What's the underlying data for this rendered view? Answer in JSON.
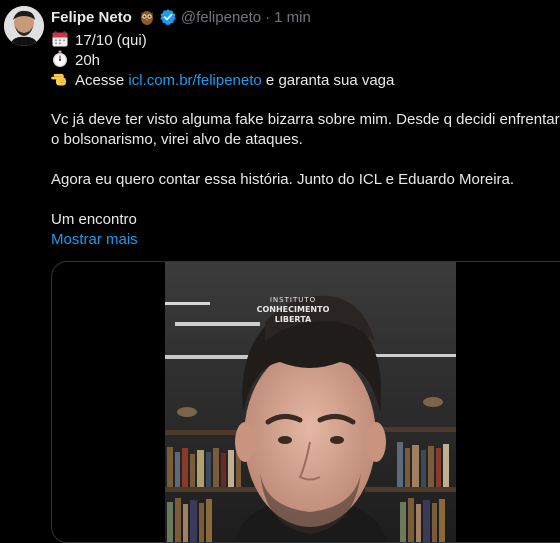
{
  "tweet": {
    "author_name": "Felipe Neto",
    "handle": "@felipeneto",
    "separator": "·",
    "time": "1 min",
    "lines": [
      {
        "emoji": "calendar-icon",
        "text": "17/10 (qui)"
      },
      {
        "emoji": "stopwatch-icon",
        "text": "20h"
      }
    ],
    "link_line": {
      "emoji": "pointing-hand-icon",
      "before": "Acesse ",
      "link": "icl.com.br/felipeneto",
      "after": " e garanta sua vaga"
    },
    "paragraph1": "Vc já deve ter visto alguma fake bizarra sobre mim. Desde q decidi enfrentar",
    "paragraph1b": "o bolsonarismo, virei alvo de ataques.",
    "paragraph2": "Agora eu quero contar essa história. Junto do ICL e Eduardo Moreira.",
    "paragraph3": "Um encontro",
    "show_more": "Mostrar mais"
  },
  "media": {
    "brand_small": "INSTITUTO",
    "brand_line1": "CONHECIMENTO",
    "brand_line2": "LIBERTA"
  },
  "colors": {
    "link": "#1d9bf0",
    "muted": "#71767b",
    "text": "#e7e9ea",
    "verified": "#1d9bf0"
  }
}
